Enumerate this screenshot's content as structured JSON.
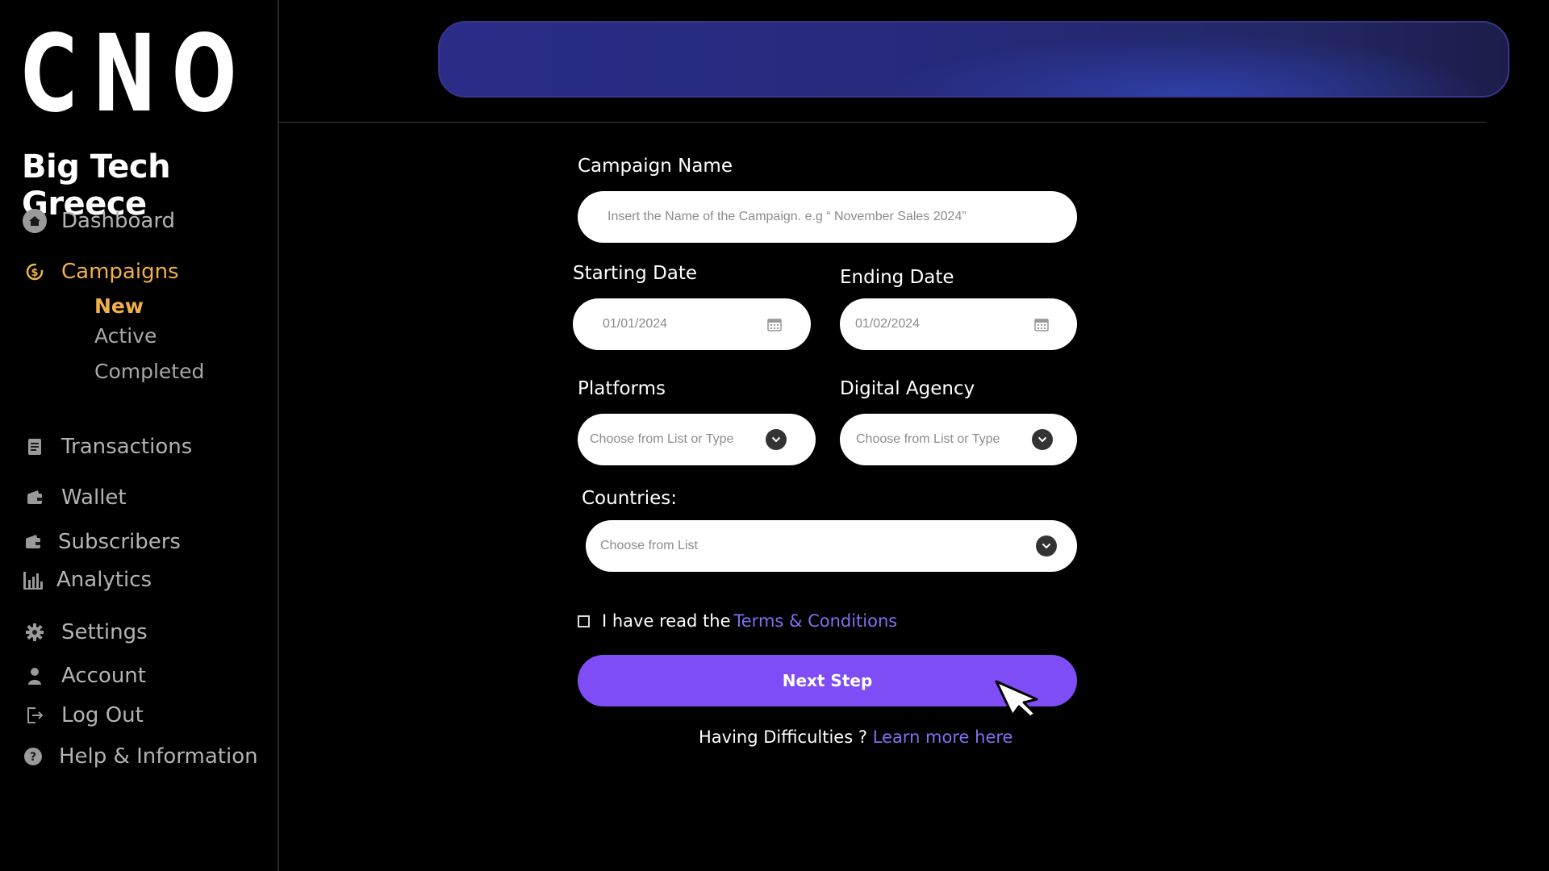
{
  "sidebar": {
    "logo": "CNO",
    "brand": "Big Tech Greece",
    "nav": {
      "dashboard": "Dashboard",
      "campaigns": "Campaigns",
      "transactions": "Transactions",
      "wallet": "Wallet",
      "subscribers": "Subscribers",
      "analytics": "Analytics",
      "settings": "Settings",
      "account": "Account",
      "logout": "Log Out",
      "help": "Help & Information"
    },
    "campaign_sub": {
      "new": "New",
      "active": "Active",
      "completed": "Completed"
    },
    "active_color": "#f2b04a"
  },
  "form": {
    "campaign_name_label": "Campaign Name",
    "campaign_name_placeholder": "Insert the Name of the Campaign. e.g “ November Sales 2024”",
    "start_label": "Starting Date",
    "start_value": "01/01/2024",
    "end_label": "Ending Date",
    "end_value": "01/02/2024",
    "platforms_label": "Platforms",
    "platforms_placeholder": "Choose from List or Type",
    "agency_label": "Digital Agency",
    "agency_placeholder": "Choose from List or Type",
    "countries_label": "Countries:",
    "countries_placeholder": "Choose from List",
    "terms_text": "I have read the",
    "terms_link": "Terms & Conditions",
    "next_button": "Next Step",
    "help_text": "Having Difficulties ?",
    "help_link": "Learn more here",
    "button_color": "#7e4df5",
    "link_color": "#7b72f0"
  }
}
